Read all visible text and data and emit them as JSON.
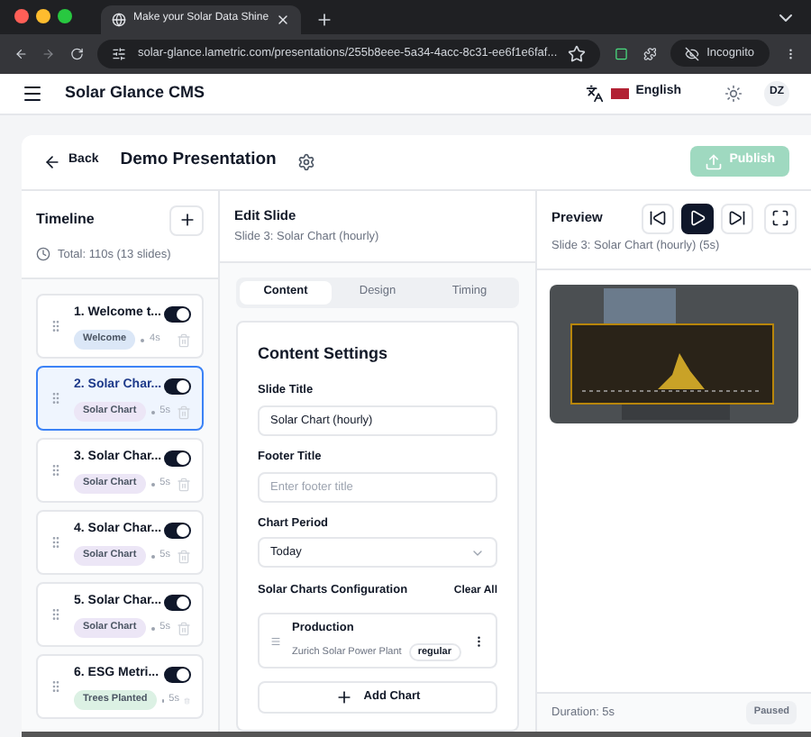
{
  "browser": {
    "tab_title": "Make your Solar Data Shine",
    "url": "solar-glance.lametric.com/presentations/255b8eee-5a34-4acc-8c31-ee6f1e6faf...",
    "profile": "Incognito"
  },
  "app_header": {
    "title": "Solar Glance CMS",
    "language": "English",
    "avatar": "DZ"
  },
  "page_header": {
    "back": "Back",
    "title": "Demo Presentation",
    "publish": {
      "label": "Publish",
      "disabled": true
    }
  },
  "timeline": {
    "title": "Timeline",
    "total": "Total: 110s (13 slides)",
    "slides": [
      {
        "title": "1. Welcome t...",
        "tag": "Welcome",
        "color": "#dbe7f7",
        "duration": "4s",
        "enabled": true,
        "selected": false
      },
      {
        "title": "2. Solar Char...",
        "tag": "Solar Chart",
        "color": "#ece6f6",
        "duration": "5s",
        "enabled": true,
        "selected": true
      },
      {
        "title": "3. Solar Char...",
        "tag": "Solar Chart",
        "color": "#ece6f6",
        "duration": "5s",
        "enabled": true,
        "selected": false
      },
      {
        "title": "4. Solar Char...",
        "tag": "Solar Chart",
        "color": "#ece6f6",
        "duration": "5s",
        "enabled": true,
        "selected": false
      },
      {
        "title": "5. Solar Char...",
        "tag": "Solar Chart",
        "color": "#ece6f6",
        "duration": "5s",
        "enabled": true,
        "selected": false
      },
      {
        "title": "6. ESG Metri...",
        "tag": "Trees Planted",
        "color": "#dcf1e4",
        "duration": "5s",
        "enabled": true,
        "selected": false
      }
    ]
  },
  "editor": {
    "title": "Edit Slide",
    "subtitle": "Slide 3: Solar Chart (hourly)",
    "tabs": [
      {
        "label": "Content",
        "selected": true
      },
      {
        "label": "Design",
        "selected": false
      },
      {
        "label": "Timing",
        "selected": false
      }
    ],
    "section_title": "Content Settings",
    "slide_title": {
      "label": "Slide Title",
      "value": "Solar Chart (hourly)"
    },
    "footer_title": {
      "label": "Footer Title",
      "placeholder": "Enter footer title"
    },
    "chart_period": {
      "label": "Chart Period",
      "value": "Today"
    },
    "charts_config": {
      "label": "Solar Charts Configuration",
      "clear": "Clear All",
      "items": [
        {
          "name": "Production",
          "plant": "Zurich Solar Power Plant",
          "style": "regular"
        }
      ],
      "add": "Add Chart"
    }
  },
  "preview": {
    "title": "Preview",
    "subtitle": "Slide 3: Solar Chart (hourly) (5s)",
    "controls": [
      {
        "kind": "previous",
        "selected": false
      },
      {
        "kind": "play",
        "selected": true
      },
      {
        "kind": "next",
        "selected": false
      },
      {
        "kind": "fullscreen",
        "selected": false
      }
    ],
    "duration": "Duration: 5s",
    "status": "Paused"
  }
}
